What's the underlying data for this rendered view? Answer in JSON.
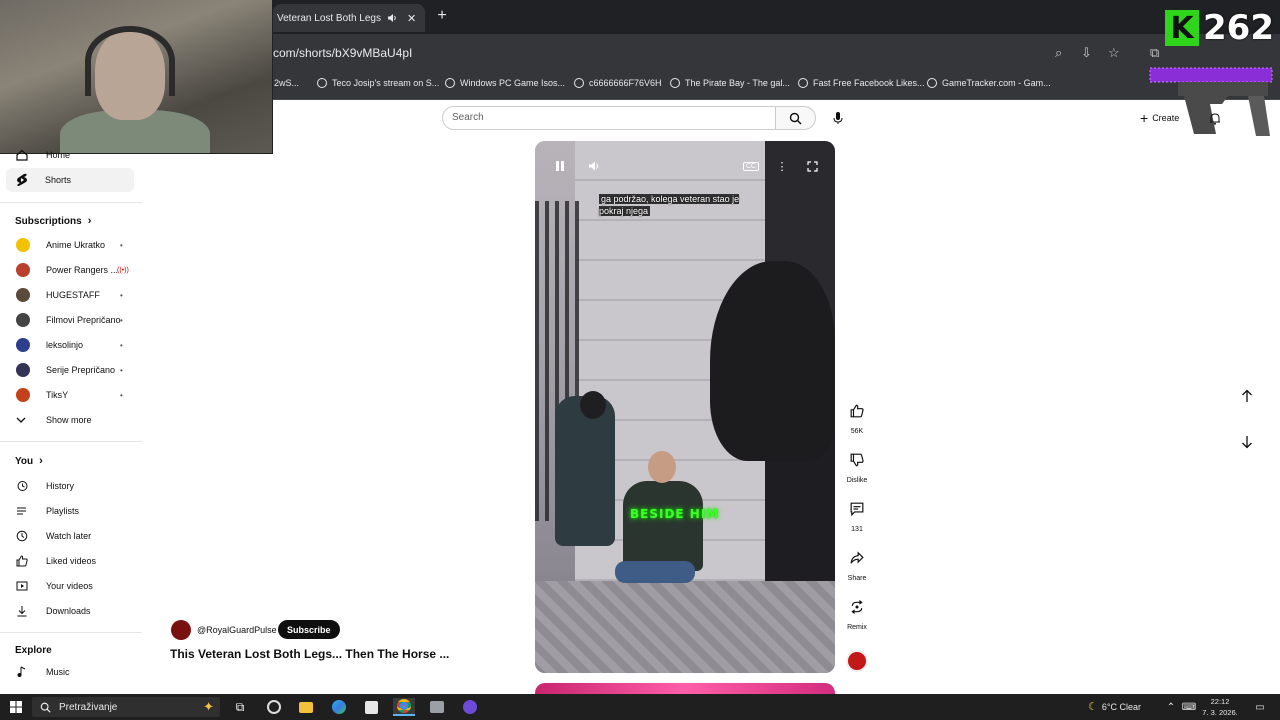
{
  "browser": {
    "tab_title": "Veteran Lost Both Legs... The",
    "url": "com/shorts/bX9vMBaU4pI",
    "bookmarks": [
      "2wS...",
      "Teco Josip's stream on S...",
      "Windows PC Game Isos...",
      "c6666666F76V6H",
      "The Pirate Bay - The gal...",
      "Fast Free Facebook Likes...",
      "GameTracker.com - Gam..."
    ]
  },
  "overlay": {
    "k_letter": "K",
    "viewer_count": "262"
  },
  "header": {
    "search_placeholder": "Search",
    "create_label": "Create"
  },
  "sidebar": {
    "top_items": [
      {
        "label": "Home",
        "icon": "home-icon"
      },
      {
        "label": "Shorts",
        "icon": "shorts-icon"
      }
    ],
    "subscriptions_title": "Subscriptions",
    "subscriptions": [
      {
        "label": "Anime Ukratko",
        "color": "#f2c200",
        "badge": "•"
      },
      {
        "label": "Power Rangers ...",
        "color": "#b8412d",
        "badge": "((•))"
      },
      {
        "label": "HUGESTAFF",
        "color": "#5a4a3a",
        "badge": "•"
      },
      {
        "label": "Filmovi Prepričano",
        "color": "#444444",
        "badge": "•"
      },
      {
        "label": "leksolinjo",
        "color": "#2d3e8c",
        "badge": "•"
      },
      {
        "label": "Serije Prepričano",
        "color": "#333355",
        "badge": "•"
      },
      {
        "label": "TiksY",
        "color": "#c4421b",
        "badge": "•"
      }
    ],
    "show_more": "Show more",
    "you_title": "You",
    "you_items": [
      {
        "label": "History",
        "icon": "history-icon"
      },
      {
        "label": "Playlists",
        "icon": "playlists-icon"
      },
      {
        "label": "Watch later",
        "icon": "watch-later-icon"
      },
      {
        "label": "Liked videos",
        "icon": "thumbs-up-icon"
      },
      {
        "label": "Your videos",
        "icon": "your-videos-icon"
      },
      {
        "label": "Downloads",
        "icon": "download-icon"
      }
    ],
    "explore_title": "Explore",
    "explore_items": [
      {
        "label": "Music",
        "icon": "music-icon"
      }
    ]
  },
  "short": {
    "caption": "ga podržao, kolega veteran stao je pokraj njega",
    "overlay_text": "BESIDE HIM",
    "channel": "@RoyalGuardPulse",
    "subscribe_label": "Subscribe",
    "title": "This Veteran Lost Both Legs... Then The Horse ..."
  },
  "actions": {
    "likes": "56K",
    "dislike": "Dislike",
    "comments": "131",
    "share": "Share",
    "remix": "Remix"
  },
  "taskbar": {
    "search_text": "Pretraživanje",
    "weather": "6°C  Clear",
    "time": "22:12",
    "date": "7. 3. 2026."
  }
}
